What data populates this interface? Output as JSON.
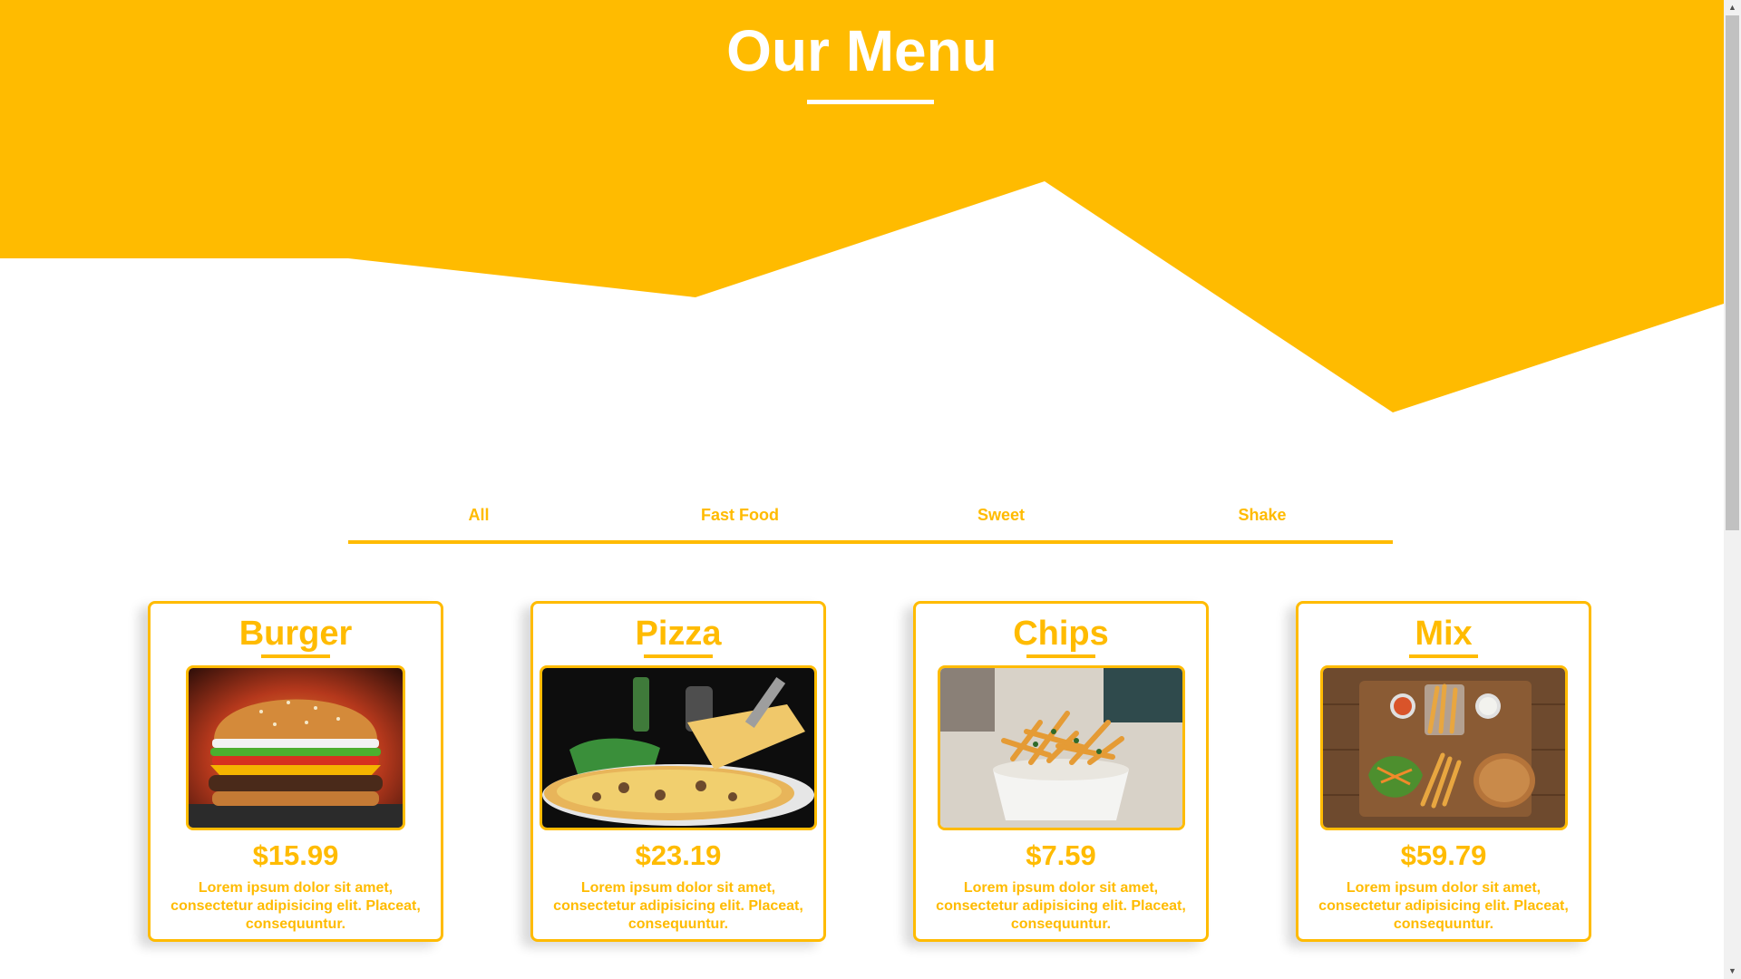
{
  "header": {
    "title": "Our Menu"
  },
  "filters": [
    {
      "label": "All"
    },
    {
      "label": "Fast Food"
    },
    {
      "label": "Sweet"
    },
    {
      "label": "Shake"
    }
  ],
  "menu": {
    "items": [
      {
        "name": "Burger",
        "price": "$15.99",
        "description": "Lorem ipsum dolor sit amet, consectetur adipisicing elit. Placeat, consequuntur.",
        "image": "burger-photo"
      },
      {
        "name": "Pizza",
        "price": "$23.19",
        "description": "Lorem ipsum dolor sit amet, consectetur adipisicing elit. Placeat, consequuntur.",
        "image": "pizza-photo"
      },
      {
        "name": "Chips",
        "price": "$7.59",
        "description": "Lorem ipsum dolor sit amet, consectetur adipisicing elit. Placeat, consequuntur.",
        "image": "chips-photo"
      },
      {
        "name": "Mix",
        "price": "$59.79",
        "description": "Lorem ipsum dolor sit amet, consectetur adipisicing elit. Placeat, consequuntur.",
        "image": "mix-platter-photo"
      }
    ]
  },
  "colors": {
    "accent": "#ffbb00",
    "background": "#ffffff",
    "title_text": "#ffffff"
  },
  "scrollbar": {
    "up_icon": "triangle-up-icon",
    "down_icon": "triangle-down-icon"
  }
}
